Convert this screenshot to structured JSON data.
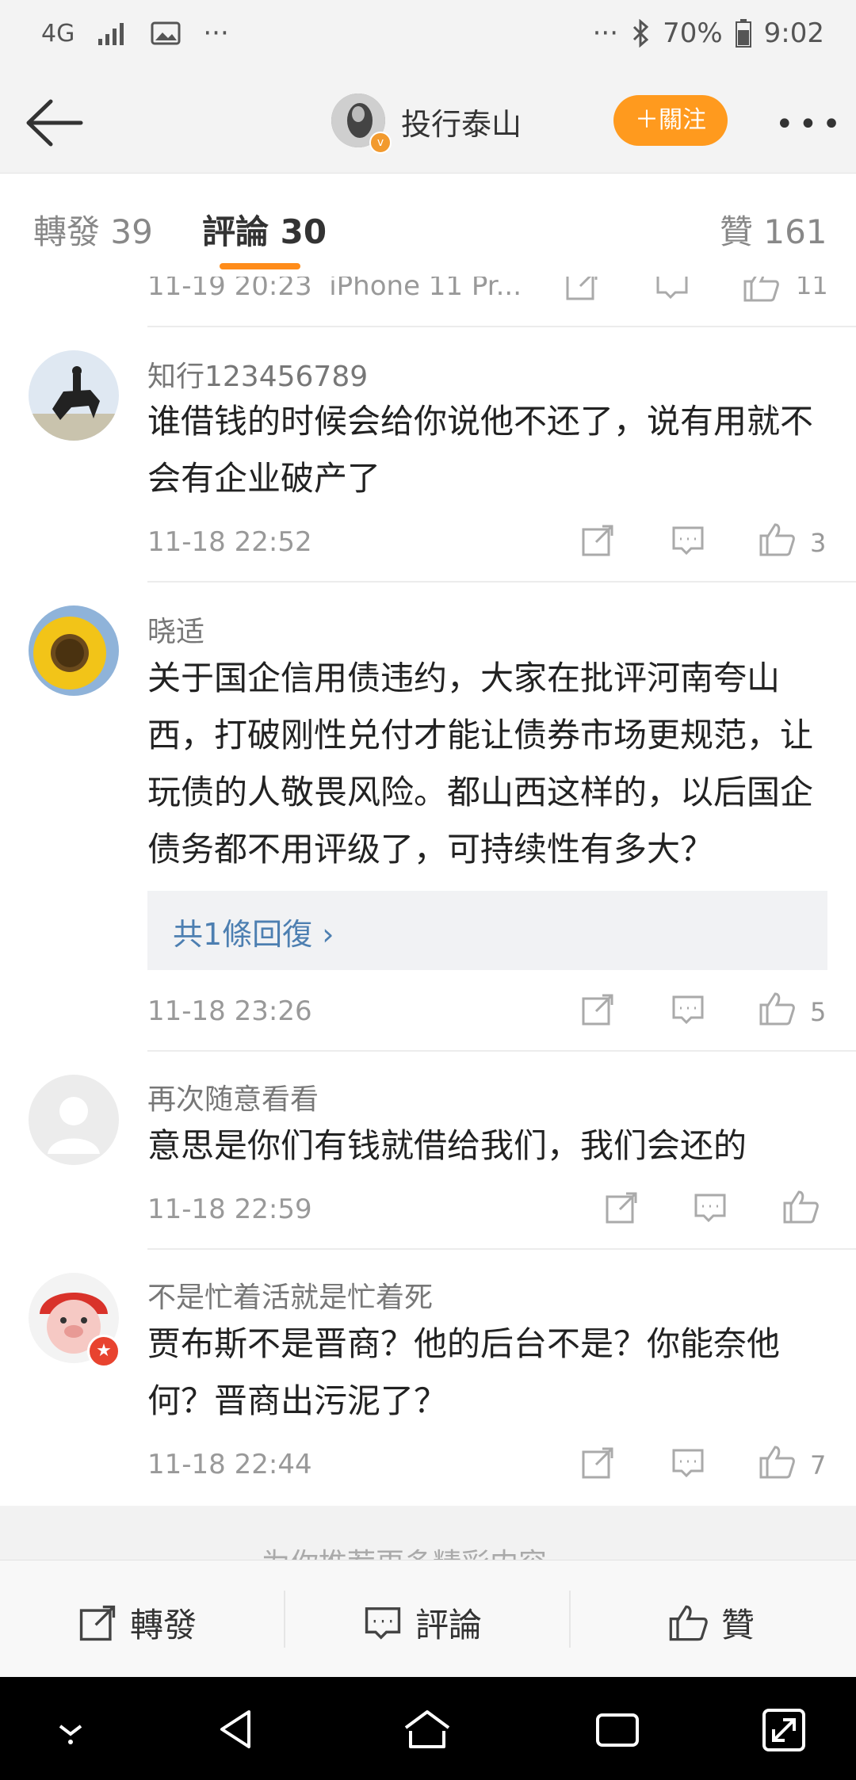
{
  "status_bar": {
    "network": "4G",
    "battery": "70%",
    "time": "9:02"
  },
  "header": {
    "username": "投行泰山",
    "follow_label": "＋關注",
    "more_label": "•••"
  },
  "tabs": {
    "repost": "轉發 39",
    "comments": "評論 30",
    "likes": "贊 161"
  },
  "partial_row": {
    "time": "11-19 20:23",
    "source": "iPhone 11 Pr...",
    "likes": "11"
  },
  "comments": [
    {
      "user": "知行123456789",
      "text": "谁借钱的时候会给你说他不还了，说有用就不会有企业破产了",
      "time": "11-18 22:52",
      "likes": "3"
    },
    {
      "user": "晓适",
      "text": "关于国企信用债违约，大家在批评河南夸山西，打破刚性兑付才能让债券市场更规范，让玩债的人敬畏风险。都山西这样的，以后国企债务都不用评级了，可持续性有多大？",
      "time": "11-18 23:26",
      "likes": "5",
      "reply_link": "共1條回復 ›"
    },
    {
      "user": "再次随意看看",
      "text": "意思是你们有钱就借给我们，我们会还的",
      "time": "11-18 22:59",
      "likes": ""
    },
    {
      "user": "不是忙着活就是忙着死",
      "text": "贾布斯不是晋商？他的后台不是？你能奈他何？晋商出污泥了？",
      "time": "11-18 22:44",
      "likes": "7"
    }
  ],
  "recommend_text": "为你推荐更多精彩内容",
  "bottom_bar": {
    "repost": "轉發",
    "comment": "評論",
    "like": "贊"
  },
  "colors": {
    "accent": "#ff8c1a",
    "follow_bg": "#ff9a1e",
    "link": "#4d7fb1"
  }
}
